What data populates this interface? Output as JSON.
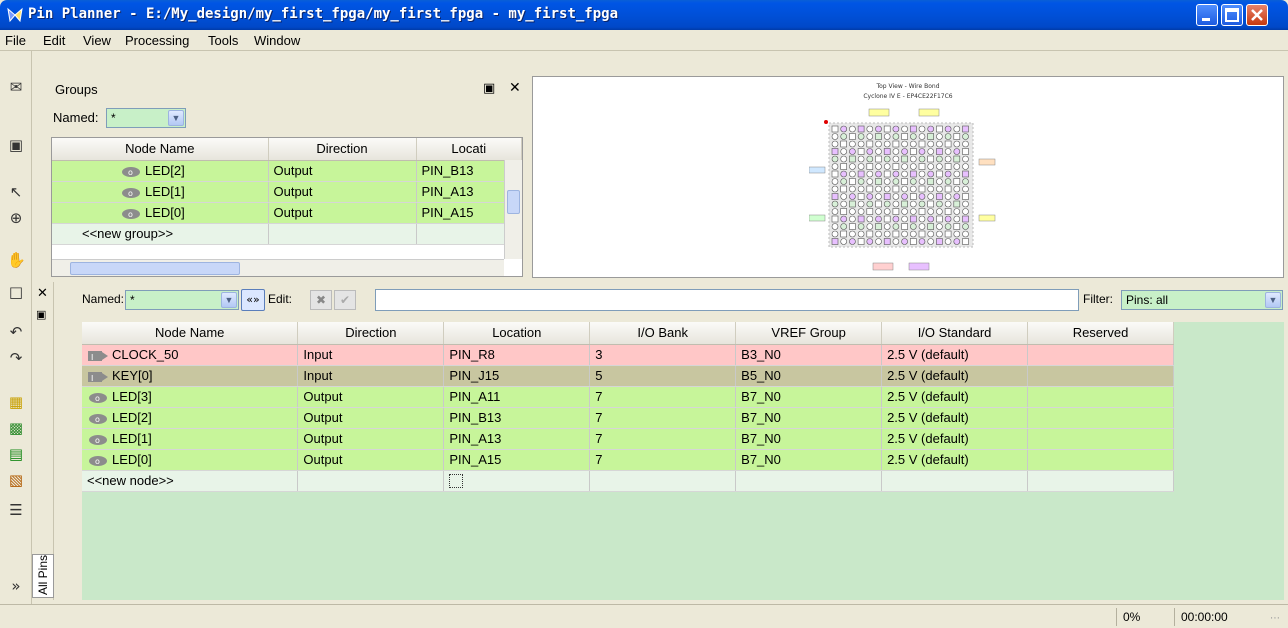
{
  "window": {
    "title": "Pin Planner - E:/My_design/my_first_fpga/my_first_fpga - my_first_fpga"
  },
  "menu": [
    "File",
    "Edit",
    "View",
    "Processing",
    "Tools",
    "Window"
  ],
  "groups": {
    "panel_title": "Groups",
    "named_label": "Named:",
    "named_value": "*",
    "columns": [
      "Node Name",
      "Direction",
      "Locati"
    ],
    "rows": [
      {
        "name": "LED[2]",
        "direction": "Output",
        "location": "PIN_B13"
      },
      {
        "name": "LED[1]",
        "direction": "Output",
        "location": "PIN_A13"
      },
      {
        "name": "LED[0]",
        "direction": "Output",
        "location": "PIN_A15"
      }
    ],
    "new_group": "<<new group>>"
  },
  "package": {
    "title": "Top View - Wire Bond",
    "device": "Cyclone IV E - EP4CE22F17C6"
  },
  "pins": {
    "named_label": "Named:",
    "named_value": "*",
    "edit_label": "Edit:",
    "filter_label": "Filter:",
    "filter_value": "Pins: all",
    "side_tab": "All Pins",
    "columns": [
      "Node Name",
      "Direction",
      "Location",
      "I/O Bank",
      "VREF Group",
      "I/O Standard",
      "Reserved"
    ],
    "rows": [
      {
        "name": "CLOCK_50",
        "direction": "Input",
        "location": "PIN_R8",
        "bank": "3",
        "vref": "B3_N0",
        "standard": "2.5 V (default)",
        "reserved": "",
        "kind": "input",
        "color": "pink"
      },
      {
        "name": "KEY[0]",
        "direction": "Input",
        "location": "PIN_J15",
        "bank": "5",
        "vref": "B5_N0",
        "standard": "2.5 V (default)",
        "reserved": "",
        "kind": "input",
        "color": "olive"
      },
      {
        "name": "LED[3]",
        "direction": "Output",
        "location": "PIN_A11",
        "bank": "7",
        "vref": "B7_N0",
        "standard": "2.5 V (default)",
        "reserved": "",
        "kind": "output",
        "color": "green"
      },
      {
        "name": "LED[2]",
        "direction": "Output",
        "location": "PIN_B13",
        "bank": "7",
        "vref": "B7_N0",
        "standard": "2.5 V (default)",
        "reserved": "",
        "kind": "output",
        "color": "green"
      },
      {
        "name": "LED[1]",
        "direction": "Output",
        "location": "PIN_A13",
        "bank": "7",
        "vref": "B7_N0",
        "standard": "2.5 V (default)",
        "reserved": "",
        "kind": "output",
        "color": "green"
      },
      {
        "name": "LED[0]",
        "direction": "Output",
        "location": "PIN_A15",
        "bank": "7",
        "vref": "B7_N0",
        "standard": "2.5 V (default)",
        "reserved": "",
        "kind": "output",
        "color": "green"
      }
    ],
    "new_node": "<<new node>>"
  },
  "status": {
    "progress": "0%",
    "time": "00:00:00"
  },
  "colors": {
    "pink": "#ffc7c7",
    "olive": "#c8c6a0",
    "green": "#c7f59a",
    "titlebar": "#0050d8"
  }
}
